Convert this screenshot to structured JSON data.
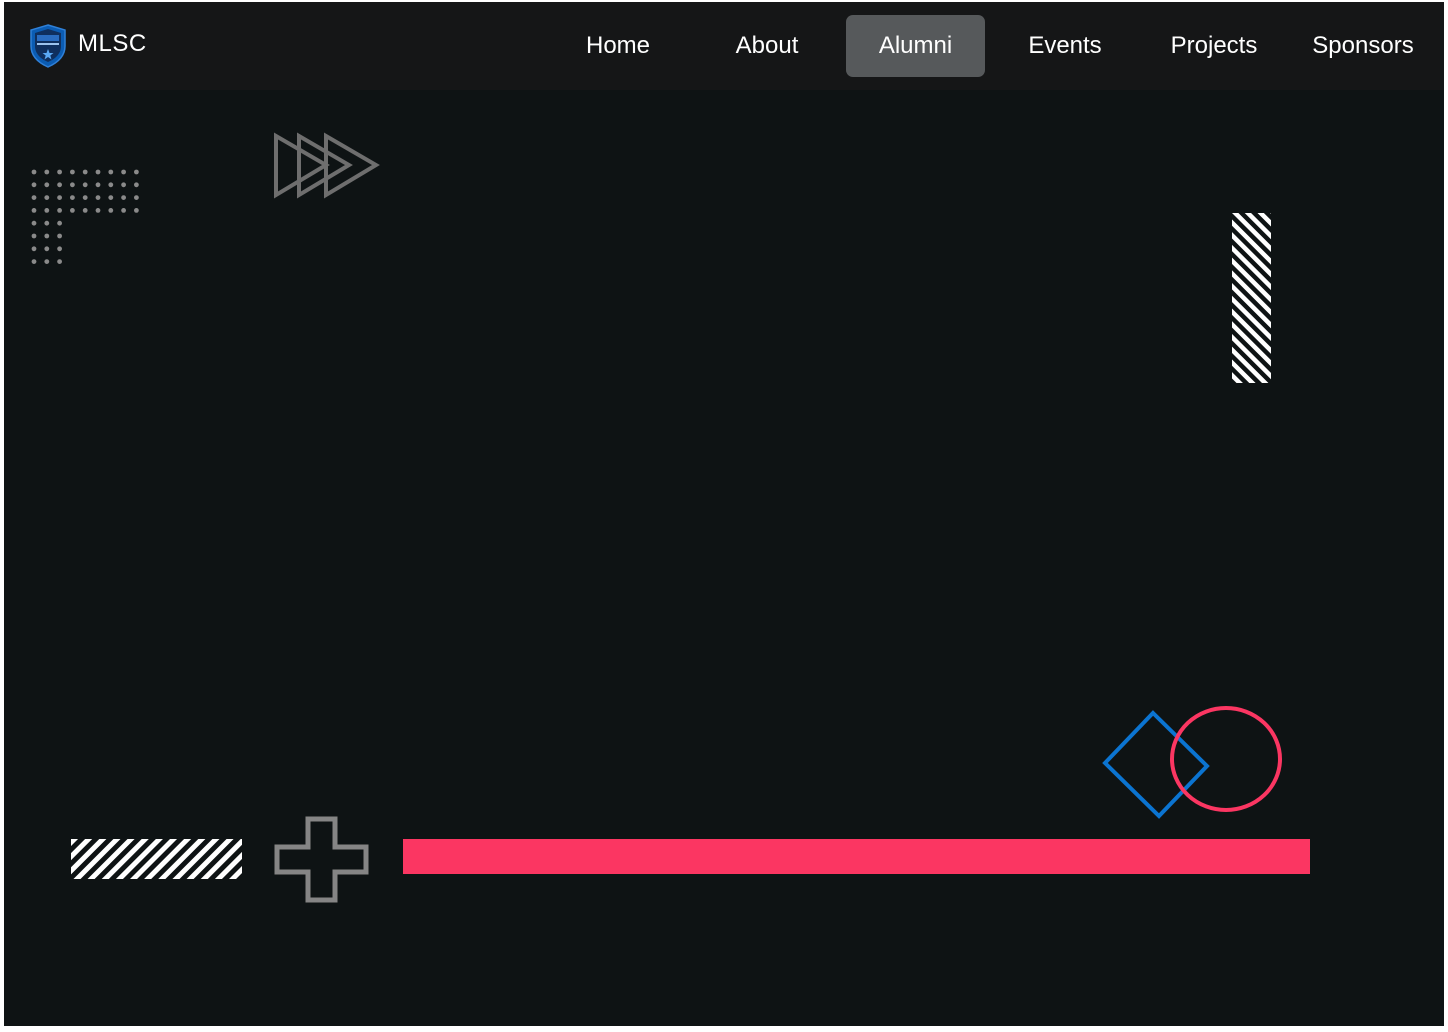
{
  "brand": {
    "name": "MLSC",
    "logo_icon": "shield-badge-icon"
  },
  "nav": {
    "items": [
      {
        "label": "Home",
        "active": false
      },
      {
        "label": "About",
        "active": false
      },
      {
        "label": "Alumni",
        "active": true
      },
      {
        "label": "Events",
        "active": false
      },
      {
        "label": "Projects",
        "active": false
      },
      {
        "label": "Sponsors",
        "active": false
      }
    ]
  },
  "colors": {
    "background": "#0e1314",
    "navbar": "#151617",
    "active_nav": "#56595b",
    "accent_pink": "#fb3662",
    "accent_blue": "#0b74d1",
    "shape_gray": "#7a7a7a"
  },
  "decorations": [
    "dot-grid-icon",
    "triple-triangle-icon",
    "striped-vertical-bar-icon",
    "blue-diamond-outline-icon",
    "pink-circle-outline-icon",
    "striped-horizontal-bar-icon",
    "plus-outline-icon",
    "pink-bar-icon"
  ]
}
